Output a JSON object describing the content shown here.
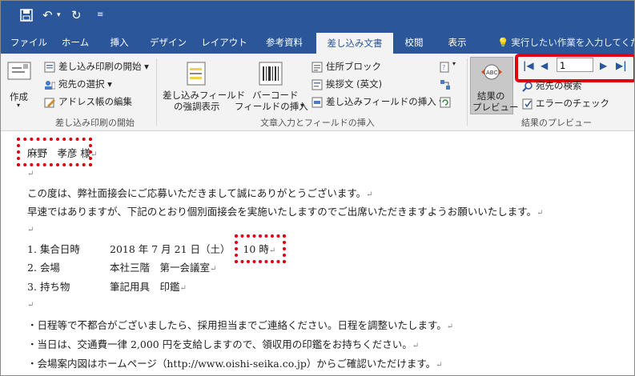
{
  "ribbon_tabs": [
    "ファイル",
    "ホーム",
    "挿入",
    "デザイン",
    "レイアウト",
    "参考資料",
    "差し込み文書",
    "校閲",
    "表示"
  ],
  "tell_me": "実行したい作業を入力してください",
  "ribbon": {
    "create": "作成",
    "start_merge": "差し込み印刷の開始",
    "select_recipients": "宛先の選択",
    "edit_address_book": "アドレス帳の編集",
    "group_start": "差し込み印刷の開始",
    "highlight_fields_1": "差し込みフィールド",
    "highlight_fields_2": "の強調表示",
    "barcode_1": "バーコード",
    "barcode_2": "フィールドの挿入",
    "address_block": "住所ブロック",
    "greeting_line": "挨拶文 (英文)",
    "insert_merge_field": "差し込みフィールドの挿入",
    "group_write": "文章入力とフィールドの挿入",
    "preview_1": "結果の",
    "preview_2": "プレビュー",
    "record_number": "1",
    "find_recipient": "宛先の検索",
    "check_errors": "エラーのチェック",
    "group_preview": "結果のプレビュー"
  },
  "document": {
    "line1_name": "麻野　孝彦",
    "line1_suffix": "様",
    "line3": "この度は、弊社面接会にご応募いただきまして誠にありがとうございます。",
    "line4": "早速ではありますが、下記のとおり個別面接会を実施いたしますのでご出席いただきますようお願いいたします。",
    "item1_label": "1.  集合日時",
    "item1_value": "2018 年 7 月 21 日（土）",
    "item1_time": "10 時",
    "item2_label": "2.  会場",
    "item2_value": "本社三階　第一会議室",
    "item3_label": "3.  持ち物",
    "item3_value": "筆記用具　印鑑",
    "note1": "・日程等で不都合がございましたら、採用担当までご連絡ください。日程を調整いたします。",
    "note2": "・当日は、交通費一律 2,000 円を支給しますので、領収用の印鑑をお持ちください。",
    "note3": "・会場案内図はホームページ（http://www.oishi-seika.co.jp）からご確認いただけます。"
  }
}
